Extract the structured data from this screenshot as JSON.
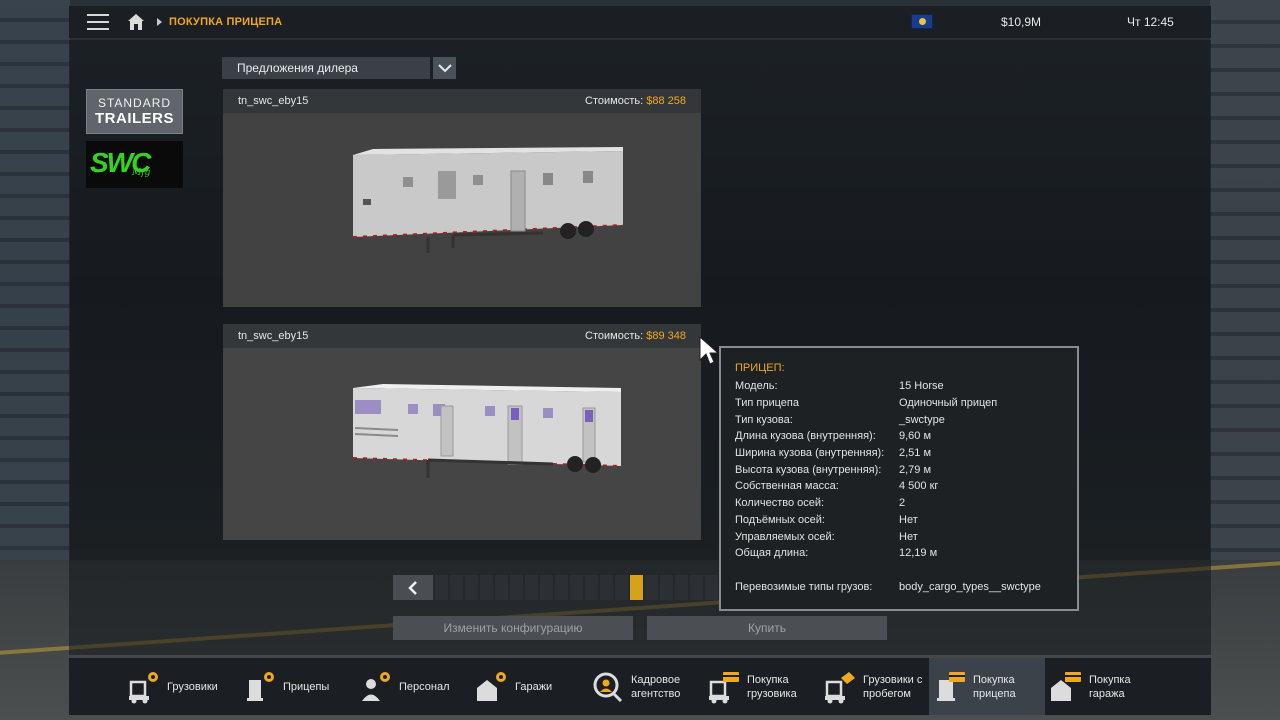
{
  "topbar": {
    "breadcrumb": "ПОКУПКА ПРИЦЕПА",
    "money": "$10,9M",
    "clock": "Чт 12:45"
  },
  "brands": {
    "standard_line1": "STANDARD",
    "standard_line2": "TRAILERS",
    "swc_logo": "SWC",
    "swc_sub": "Mfg"
  },
  "filter": {
    "selected": "Предложения дилера"
  },
  "offers": [
    {
      "name": "tn_swc_eby15",
      "price_label": "Стоимость:",
      "price": "$88 258"
    },
    {
      "name": "tn_swc_eby15",
      "price_label": "Стоимость:",
      "price": "$89 348"
    }
  ],
  "pager": {
    "current": 14,
    "total": 20
  },
  "actions": {
    "configure": "Изменить конфигурацию",
    "buy": "Купить"
  },
  "tooltip": {
    "title": "ПРИЦЕП:",
    "rows": [
      {
        "k": "Модель:",
        "v": "15 Horse"
      },
      {
        "k": "Тип прицепа",
        "v": "Одиночный прицеп"
      },
      {
        "k": "Тип кузова:",
        "v": "_swctype"
      },
      {
        "k": "Длина кузова (внутренняя):",
        "v": "9,60 м"
      },
      {
        "k": "Ширина кузова (внутренняя):",
        "v": "2,51 м"
      },
      {
        "k": "Высота кузова (внутренняя):",
        "v": "2,79 м"
      },
      {
        "k": "Собственная масса:",
        "v": "4 500 кг"
      },
      {
        "k": "Количество осей:",
        "v": "2"
      },
      {
        "k": "Подъёмных осей:",
        "v": "Нет"
      },
      {
        "k": "Управляемых осей:",
        "v": "Нет"
      },
      {
        "k": "Общая длина:",
        "v": "12,19 м"
      },
      {
        "k": "Перевозимые типы грузов:",
        "v": "body_cargo_types__swctype"
      }
    ]
  },
  "bottom_nav": [
    {
      "label": "Грузовики",
      "icon": "truck-gear-icon"
    },
    {
      "label": "Прицепы",
      "icon": "trailer-gear-icon"
    },
    {
      "label": "Персонал",
      "icon": "person-gear-icon"
    },
    {
      "label": "Гаражи",
      "icon": "garage-gear-icon"
    },
    {
      "label": "Кадровое\nагентство",
      "icon": "agency-search-icon"
    },
    {
      "label": "Покупка\nгрузовика",
      "icon": "buy-truck-icon"
    },
    {
      "label": "Грузовики с\nпробегом",
      "icon": "used-truck-icon"
    },
    {
      "label": "Покупка\nприцепа",
      "icon": "buy-trailer-icon",
      "active": true
    },
    {
      "label": "Покупка\nгаража",
      "icon": "buy-garage-icon"
    }
  ],
  "colors": {
    "accent": "#f0a81c",
    "active_page": "#d7a11a"
  }
}
